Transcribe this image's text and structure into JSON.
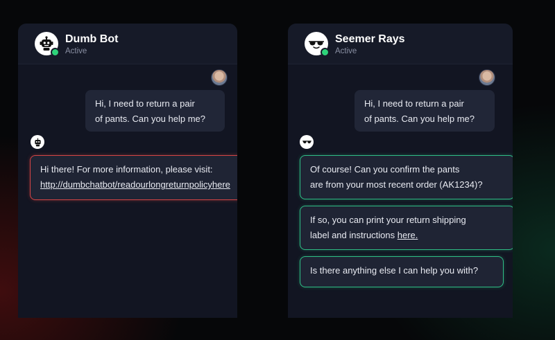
{
  "left_chat": {
    "bot_name": "Dumb Bot",
    "status": "Active",
    "user_message": {
      "line1": "Hi, I need to return a pair",
      "line2": "of pants. Can you help me?"
    },
    "bot_message": {
      "line1": "Hi there! For more information, please visit:",
      "link": "http://dumbchatbot/readourlongreturnpolicyhere"
    },
    "bot_icon": "robot-icon",
    "accent_color": "#d64545"
  },
  "right_chat": {
    "bot_name": "Seemer Rays",
    "status": "Active",
    "user_message": {
      "line1": "Hi, I need to return a pair",
      "line2": "of pants. Can you help me?"
    },
    "bot_messages": [
      {
        "line1": "Of course!  Can you confirm the pants",
        "line2": "are from your most recent order (AK1234)?"
      },
      {
        "line1": "If so, you can print your return shipping",
        "line2_prefix": "label and instructions ",
        "link": "here."
      },
      {
        "line1": "Is there anything else I can help you with?"
      }
    ],
    "bot_icon": "sunglasses-icon",
    "accent_color": "#2fbf86"
  },
  "status_color": "#2ed37a"
}
